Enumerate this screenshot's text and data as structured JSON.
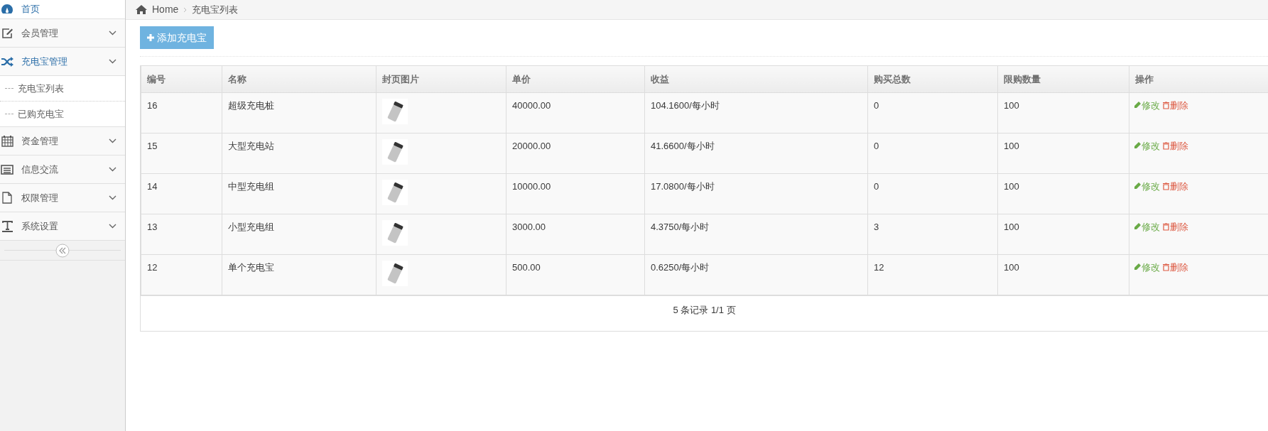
{
  "sidebar": {
    "items": [
      {
        "label": "首页",
        "kind": "link",
        "active": true
      },
      {
        "label": "会员管理",
        "kind": "menu",
        "active": false
      },
      {
        "label": "充电宝管理",
        "kind": "menu",
        "active": true,
        "children": [
          {
            "label": "充电宝列表",
            "selected": false
          },
          {
            "label": "已购充电宝",
            "selected": false
          }
        ]
      },
      {
        "label": "资金管理",
        "kind": "menu",
        "active": false
      },
      {
        "label": "信息交流",
        "kind": "menu",
        "active": false
      },
      {
        "label": "权限管理",
        "kind": "menu",
        "active": false
      },
      {
        "label": "系统设置",
        "kind": "menu",
        "active": false
      }
    ]
  },
  "breadcrumb": [
    "Home",
    "充电宝列表"
  ],
  "add_button": "添加充电宝",
  "table": {
    "columns": [
      "编号",
      "名称",
      "封页图片",
      "单价",
      "收益",
      "购买总数",
      "限购数量",
      "操作"
    ],
    "rows": [
      {
        "cells": [
          "16",
          "超级充电桩",
          "",
          "40000.00",
          "104.1600/每小时",
          "0",
          "100"
        ],
        "actions": [
          "修改",
          "删除"
        ]
      },
      {
        "cells": [
          "15",
          "大型充电站",
          "",
          "20000.00",
          "41.6600/每小时",
          "0",
          "100"
        ],
        "actions": [
          "修改",
          "删除"
        ]
      },
      {
        "cells": [
          "14",
          "中型充电组",
          "",
          "10000.00",
          "17.0800/每小时",
          "0",
          "100"
        ],
        "actions": [
          "修改",
          "删除"
        ]
      },
      {
        "cells": [
          "13",
          "小型充电组",
          "",
          "3000.00",
          "4.3750/每小时",
          "3",
          "100"
        ],
        "actions": [
          "修改",
          "删除"
        ]
      },
      {
        "cells": [
          "12",
          "单个充电宝",
          "",
          "500.00",
          "0.6250/每小时",
          "12",
          "100"
        ],
        "actions": [
          "修改",
          "删除"
        ]
      }
    ],
    "pagination": "5 条记录 1/1 页"
  }
}
